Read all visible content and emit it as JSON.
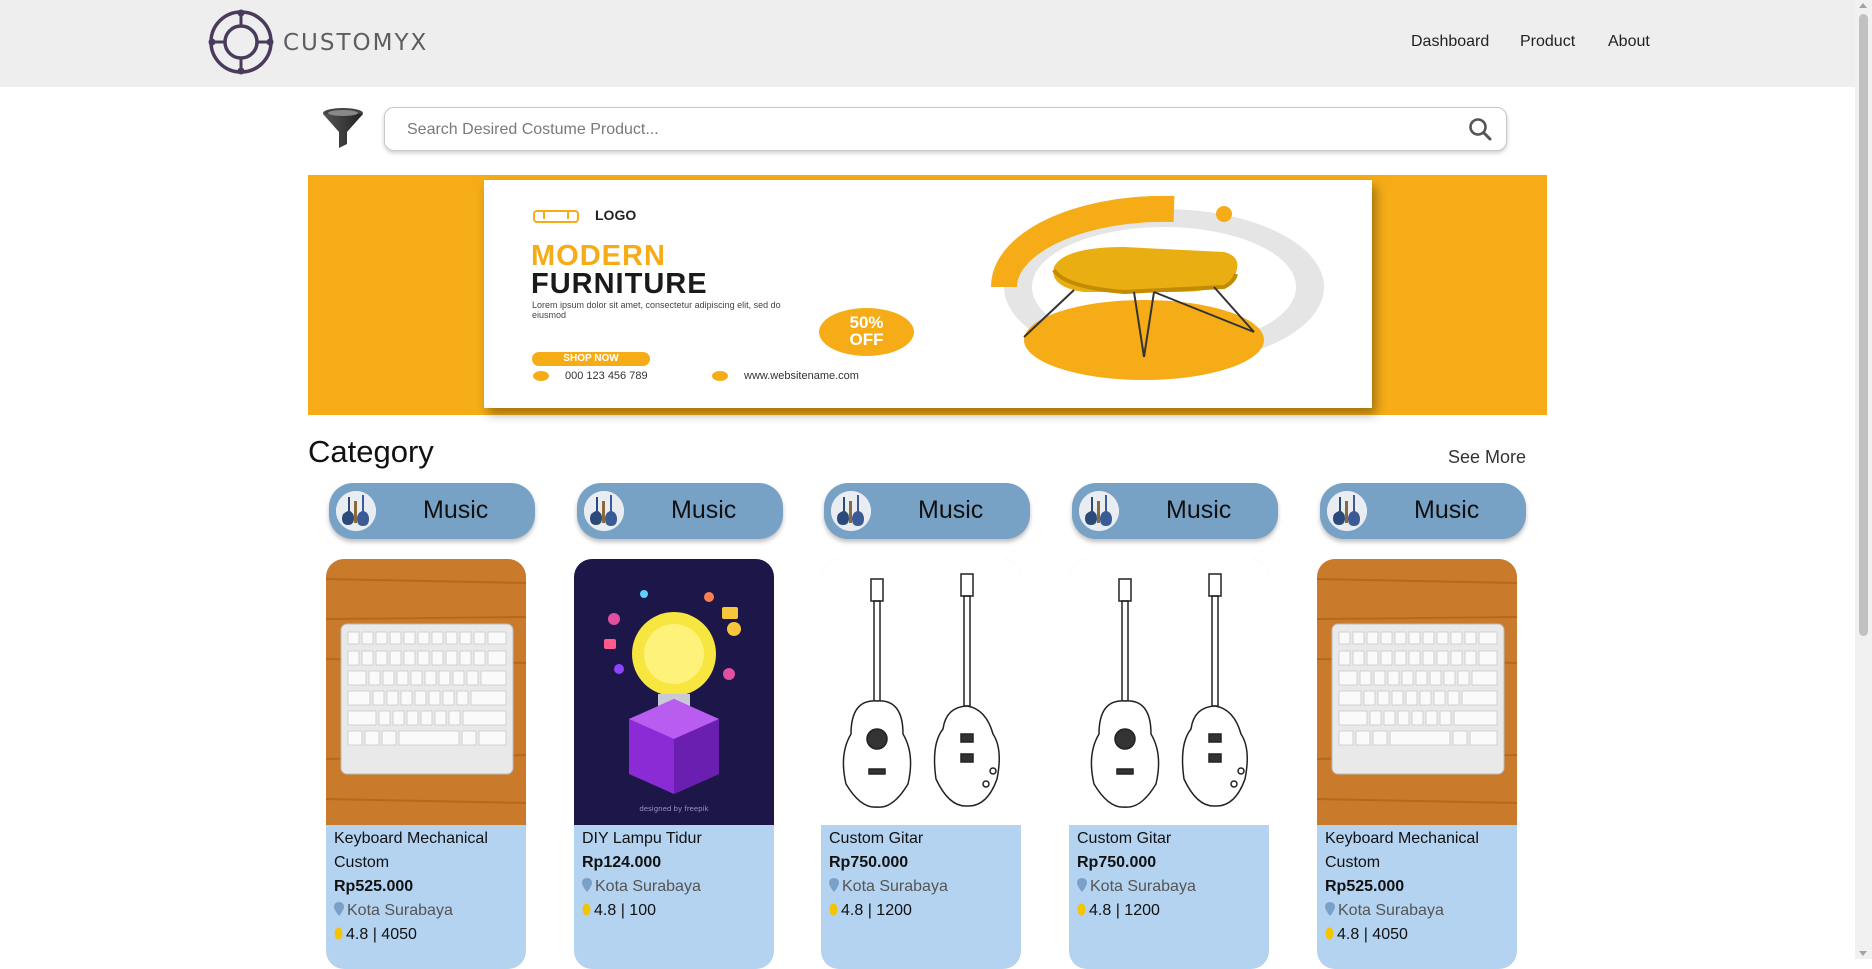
{
  "brand": {
    "name": "CUSTOMYX"
  },
  "nav": {
    "items": [
      "Dashboard",
      "Product",
      "About"
    ]
  },
  "search": {
    "placeholder": "Search Desired Costume Product..."
  },
  "banner": {
    "logo_text": "LOGO",
    "title_line1": "MODERN",
    "title_line2": "FURNITURE",
    "lorem": "Lorem ipsum dolor sit amet, consectetur adipiscing elit, sed do eiusmod",
    "discount_line1": "50%",
    "discount_line2": "OFF",
    "cta": "SHOP NOW",
    "phone": "000 123 456 789",
    "website": "www.websitename.com"
  },
  "category": {
    "title": "Category",
    "see_more": "See More",
    "items": [
      {
        "label": "Music",
        "icon": "guitar-icon"
      },
      {
        "label": "Music",
        "icon": "guitar-icon"
      },
      {
        "label": "Music",
        "icon": "guitar-icon"
      },
      {
        "label": "Music",
        "icon": "guitar-icon"
      },
      {
        "label": "Music",
        "icon": "guitar-icon"
      }
    ]
  },
  "products": [
    {
      "name": "Keyboard Mechanical Custom",
      "price": "Rp525.000",
      "location": "Kota Surabaya",
      "rating": "4.8 | 4050",
      "image": "keyboard"
    },
    {
      "name": "DIY Lampu Tidur",
      "price": "Rp124.000",
      "location": "Kota Surabaya",
      "rating": "4.8 | 100",
      "image": "lightbulb"
    },
    {
      "name": "Custom Gitar",
      "price": "Rp750.000",
      "location": "Kota Surabaya",
      "rating": "4.8 | 1200",
      "image": "guitars"
    },
    {
      "name": "Custom Gitar",
      "price": "Rp750.000",
      "location": "Kota Surabaya",
      "rating": "4.8 | 1200",
      "image": "guitars"
    },
    {
      "name": "Keyboard Mechanical Custom",
      "price": "Rp525.000",
      "location": "Kota Surabaya",
      "rating": "4.8 | 4050",
      "image": "keyboard"
    }
  ],
  "colors": {
    "navbar_bg": "#eeeeee",
    "accent_yellow": "#f5ac17",
    "category_pill": "#78a1c6",
    "card_bg": "#b3d3f0",
    "star": "#f5c400",
    "pin": "#7aa0c8"
  }
}
